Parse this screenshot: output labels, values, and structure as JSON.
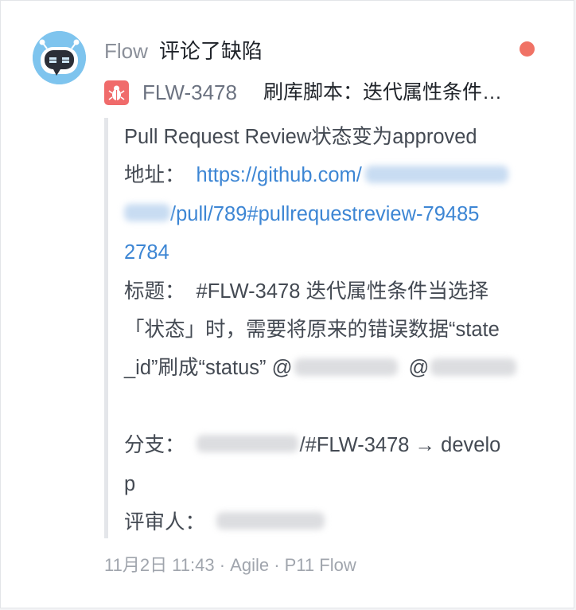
{
  "notification": {
    "sender": "Flow",
    "action": "评论了缺陷",
    "unread": true
  },
  "issue": {
    "key": "FLW-3478",
    "title": "刷库脚本：迭代属性条件…"
  },
  "comment": {
    "line1": "Pull Request Review状态变为approved",
    "address_label": "地址：",
    "url_prefix": "https://github.com/",
    "url_middle": "/pull/789#pullrequestreview-79485",
    "url_end": "2784",
    "title_label": "标题：",
    "title_line1": "#FLW-3478 迭代属性条件当选择",
    "title_line2": "「状态」时，需要将原来的错误数据“state",
    "title_line3_a": "_id”刷成“status” @",
    "title_line3_b": "@",
    "branch_label": "分支：",
    "branch_text": "/#FLW-3478 → develo",
    "branch_end": "p",
    "reviewer_label": "评审人："
  },
  "footer": {
    "text": "11月2日 11:43 · Agile · P11 Flow"
  },
  "colors": {
    "link": "#3d86d4",
    "unread_dot": "#f07265",
    "issue_icon": "#f06b6b",
    "avatar_bg": "#7ec4ee"
  }
}
